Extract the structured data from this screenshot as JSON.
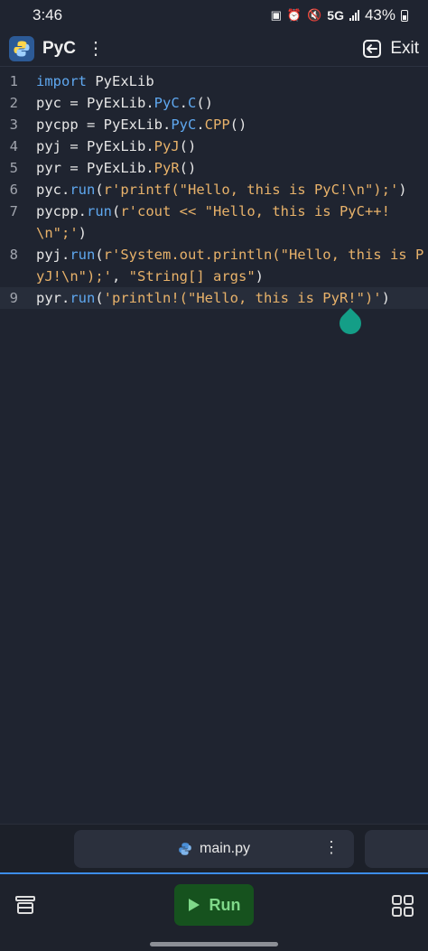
{
  "status_bar": {
    "time": "3:46",
    "network": "5G",
    "battery": "43%"
  },
  "app_bar": {
    "title": "PyC",
    "more_icon": "⋮",
    "exit_label": "Exit"
  },
  "editor": {
    "lines": [
      {
        "number": "1",
        "tokens": [
          {
            "t": "import",
            "c": "kw"
          },
          {
            "t": " PyExLib"
          }
        ]
      },
      {
        "number": "2",
        "tokens": [
          {
            "t": "pyc = PyExLib."
          },
          {
            "t": "PyC",
            "c": "cls"
          },
          {
            "t": "."
          },
          {
            "t": "C",
            "c": "cls"
          },
          {
            "t": "()"
          }
        ]
      },
      {
        "number": "3",
        "tokens": [
          {
            "t": "pycpp = PyExLib."
          },
          {
            "t": "PyC",
            "c": "cls"
          },
          {
            "t": "."
          },
          {
            "t": "CPP",
            "c": "fn"
          },
          {
            "t": "()"
          }
        ]
      },
      {
        "number": "4",
        "tokens": [
          {
            "t": "pyj = PyExLib."
          },
          {
            "t": "PyJ",
            "c": "fn"
          },
          {
            "t": "()"
          }
        ]
      },
      {
        "number": "5",
        "tokens": [
          {
            "t": "pyr = PyExLib."
          },
          {
            "t": "PyR",
            "c": "fn"
          },
          {
            "t": "()"
          }
        ]
      },
      {
        "number": "6",
        "tokens": [
          {
            "t": "pyc."
          },
          {
            "t": "run",
            "c": "cls"
          },
          {
            "t": "("
          },
          {
            "t": "r'printf(\"Hello, this is PyC!\\n\");'",
            "c": "str"
          },
          {
            "t": ")"
          }
        ]
      },
      {
        "number": "7",
        "tokens": [
          {
            "t": "pycpp."
          },
          {
            "t": "run",
            "c": "cls"
          },
          {
            "t": "("
          },
          {
            "t": "r'cout << \"Hello, this is PyC++!\\n\";'",
            "c": "str"
          },
          {
            "t": ")"
          }
        ]
      },
      {
        "number": "8",
        "tokens": [
          {
            "t": "pyj."
          },
          {
            "t": "run",
            "c": "cls"
          },
          {
            "t": "("
          },
          {
            "t": "r'System.out.println(\"Hello, this is PyJ!\\n\");'",
            "c": "str"
          },
          {
            "t": ", "
          },
          {
            "t": "\"String[] args\"",
            "c": "str"
          },
          {
            "t": ")"
          }
        ]
      },
      {
        "number": "9",
        "tokens": [
          {
            "t": "pyr."
          },
          {
            "t": "run",
            "c": "cls"
          },
          {
            "t": "("
          },
          {
            "t": "'println!(\"Hello, this is PyR!\")'",
            "c": "str"
          },
          {
            "t": ")"
          }
        ],
        "active": true
      }
    ]
  },
  "tabs": {
    "file_name": "main.py",
    "more_icon": "⋮"
  },
  "bottom_bar": {
    "run_label": "Run"
  },
  "icons": {
    "logo": "python-logo-icon",
    "exit": "exit-icon",
    "file": "python-file-icon",
    "run": "play-icon",
    "left": "layers-icon",
    "right": "grid-icon"
  },
  "colors": {
    "background": "#1f2430",
    "keyword": "#5fa8f0",
    "string": "#e8b26a",
    "run_button": "#16521e",
    "run_label": "#7fd889",
    "accent": "#3d8de8"
  }
}
